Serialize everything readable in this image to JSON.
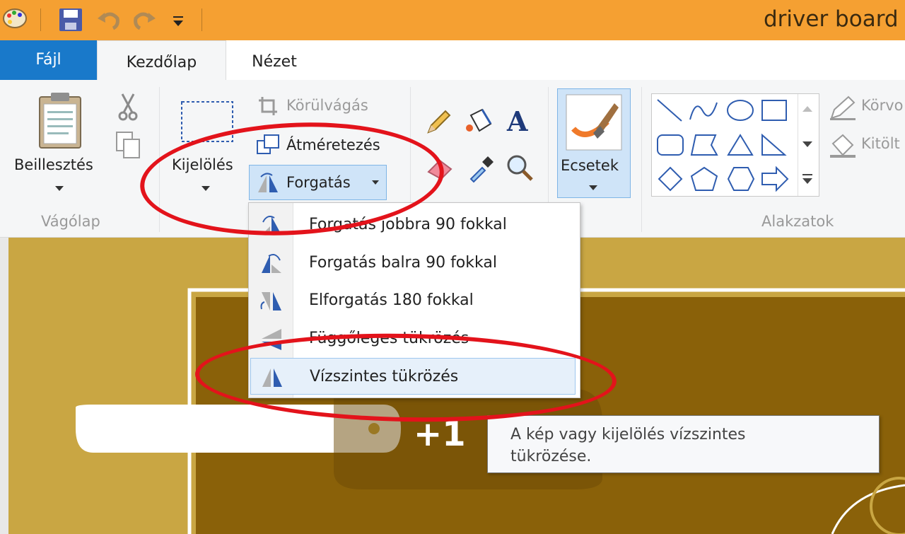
{
  "window": {
    "title": "driver board"
  },
  "tabs": {
    "file": "Fájl",
    "home": "Kezdőlap",
    "view": "Nézet"
  },
  "ribbon": {
    "clipboard": {
      "paste_label": "Beillesztés",
      "group_label": "Vágólap"
    },
    "image": {
      "select_label": "Kijelölés",
      "crop_label": "Körülvágás",
      "resize_label": "Átméretezés",
      "rotate_label": "Forgatás"
    },
    "brushes": {
      "label": "Ecsetek"
    },
    "shapes": {
      "group_label": "Alakzatok",
      "outline_label": "Körvo",
      "fill_label": "Kitölt"
    }
  },
  "rotate_menu": {
    "items": [
      {
        "label": "Forgatás jobbra 90 fokkal"
      },
      {
        "label": "Forgatás balra 90 fokkal"
      },
      {
        "label": "Elforgatás 180 fokkal"
      },
      {
        "label": "Függőleges tükrözés"
      },
      {
        "label": "Vízszintes tükrözés"
      }
    ]
  },
  "tooltip": {
    "line1": "A kép vagy kijelölés vízszintes",
    "line2": "tükrözése."
  },
  "canvas": {
    "visible_text": "+1"
  },
  "colors": {
    "titlebar": "#f5a032",
    "file_tab": "#1979ca",
    "annotation": "#e3131b",
    "board": "#8a6109",
    "canvas_bg": "#c9a643"
  }
}
